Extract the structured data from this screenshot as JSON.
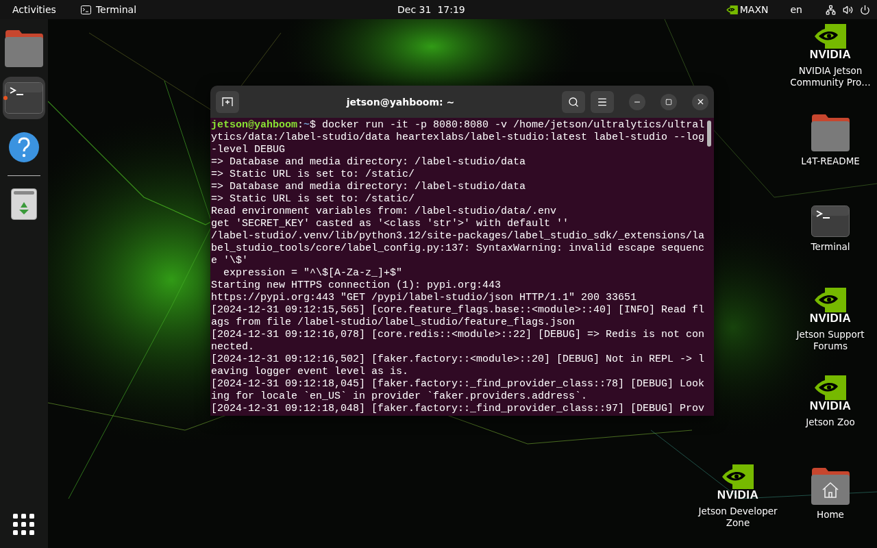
{
  "top_bar": {
    "activities": "Activities",
    "app": "Terminal",
    "date": "Dec 31",
    "time": "17:19",
    "power_mode": "MAXN",
    "language": "en"
  },
  "dock": {
    "items": [
      {
        "kind": "files",
        "running": false
      },
      {
        "kind": "terminal",
        "running": true
      },
      {
        "kind": "help",
        "running": false
      },
      {
        "kind": "separator"
      },
      {
        "kind": "trash",
        "running": false
      }
    ]
  },
  "terminal": {
    "title": "jetson@yahboom: ~",
    "prompt": {
      "user": "jetson@yahboom",
      "colon": ":",
      "path": "~",
      "command": "$ docker run -it -p 8080:8080 -v /home/jetson/ultralytics/ultral"
    },
    "lines": [
      "ytics/data:/label-studio/data heartexlabs/label-studio:latest label-studio --log",
      "-level DEBUG",
      "=> Database and media directory: /label-studio/data",
      "=> Static URL is set to: /static/",
      "=> Database and media directory: /label-studio/data",
      "=> Static URL is set to: /static/",
      "Read environment variables from: /label-studio/data/.env",
      "get 'SECRET_KEY' casted as '<class 'str'>' with default ''",
      "/label-studio/.venv/lib/python3.12/site-packages/label_studio_sdk/_extensions/la",
      "bel_studio_tools/core/label_config.py:137: SyntaxWarning: invalid escape sequenc",
      "e '\\$'",
      "  expression = \"^\\$[A-Za-z_]+$\"",
      "Starting new HTTPS connection (1): pypi.org:443",
      "https://pypi.org:443 \"GET /pypi/label-studio/json HTTP/1.1\" 200 33651",
      "[2024-12-31 09:12:15,565] [core.feature_flags.base::<module>::40] [INFO] Read fl",
      "ags from file /label-studio/label_studio/feature_flags.json",
      "[2024-12-31 09:12:16,078] [core.redis::<module>::22] [DEBUG] => Redis is not con",
      "nected.",
      "[2024-12-31 09:12:16,502] [faker.factory::<module>::20] [DEBUG] Not in REPL -> l",
      "eaving logger event level as is.",
      "[2024-12-31 09:12:18,045] [faker.factory::_find_provider_class::78] [DEBUG] Look",
      "ing for locale `en_US` in provider `faker.providers.address`.",
      "[2024-12-31 09:12:18,048] [faker.factory::_find_provider_class::97] [DEBUG] Prov"
    ]
  },
  "desktop_icons": [
    {
      "kind": "nvidia",
      "logo": "NVIDIA",
      "label": "NVIDIA Jetson Community Pro…"
    },
    {
      "kind": "folder",
      "label": "L4T-README"
    },
    {
      "kind": "terminal",
      "label": "Terminal"
    },
    {
      "kind": "nvidia",
      "logo": "NVIDIA",
      "label": "Jetson Support Forums"
    },
    {
      "kind": "nvidia",
      "logo": "NVIDIA",
      "label": "Jetson Zoo"
    },
    {
      "kind": "nvidia",
      "logo": "NVIDIA",
      "label": "Jetson Developer Zone"
    },
    {
      "kind": "home",
      "label": "Home"
    }
  ]
}
